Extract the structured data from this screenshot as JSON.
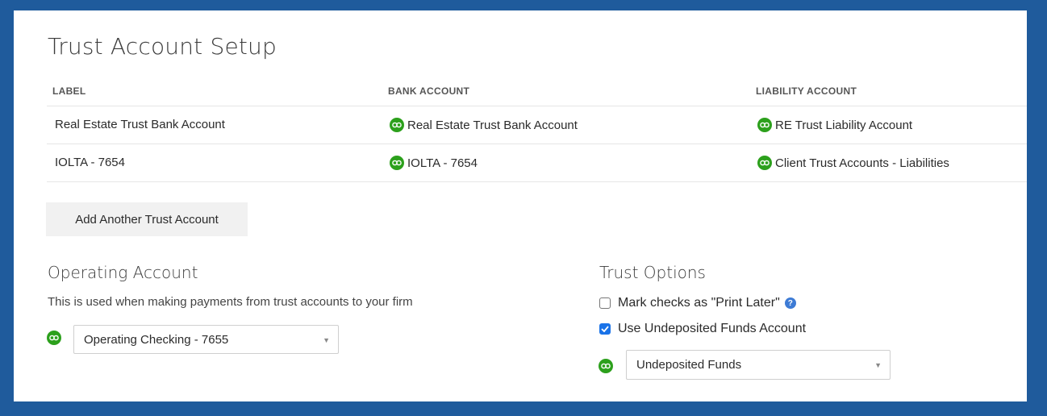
{
  "page": {
    "title": "Trust Account Setup"
  },
  "table": {
    "headers": {
      "label": "LABEL",
      "bank": "BANK ACCOUNT",
      "liability": "LIABILITY ACCOUNT"
    },
    "rows": [
      {
        "label": "Real Estate Trust Bank Account",
        "bank": "Real Estate Trust Bank Account",
        "liability": "RE Trust Liability Account"
      },
      {
        "label": "IOLTA - 7654",
        "bank": "IOLTA - 7654",
        "liability": "Client Trust Accounts - Liabilities"
      }
    ]
  },
  "add_button": {
    "label": "Add Another Trust Account"
  },
  "operating": {
    "title": "Operating Account",
    "description": "This is used when making payments from trust accounts to your firm",
    "selected": "Operating Checking - 7655"
  },
  "trust_options": {
    "title": "Trust Options",
    "print_later": {
      "label": "Mark checks as \"Print Later\"",
      "checked": false
    },
    "undeposited": {
      "label": "Use Undeposited Funds Account",
      "checked": true
    },
    "selected": "Undeposited Funds"
  },
  "icons": {
    "qb": "quickbooks-icon",
    "help": "help-icon",
    "caret": "chevron-down-icon"
  },
  "colors": {
    "frame": "#1f5b9c",
    "qb_green": "#2ca01c",
    "checkbox_blue": "#1a73e8"
  }
}
